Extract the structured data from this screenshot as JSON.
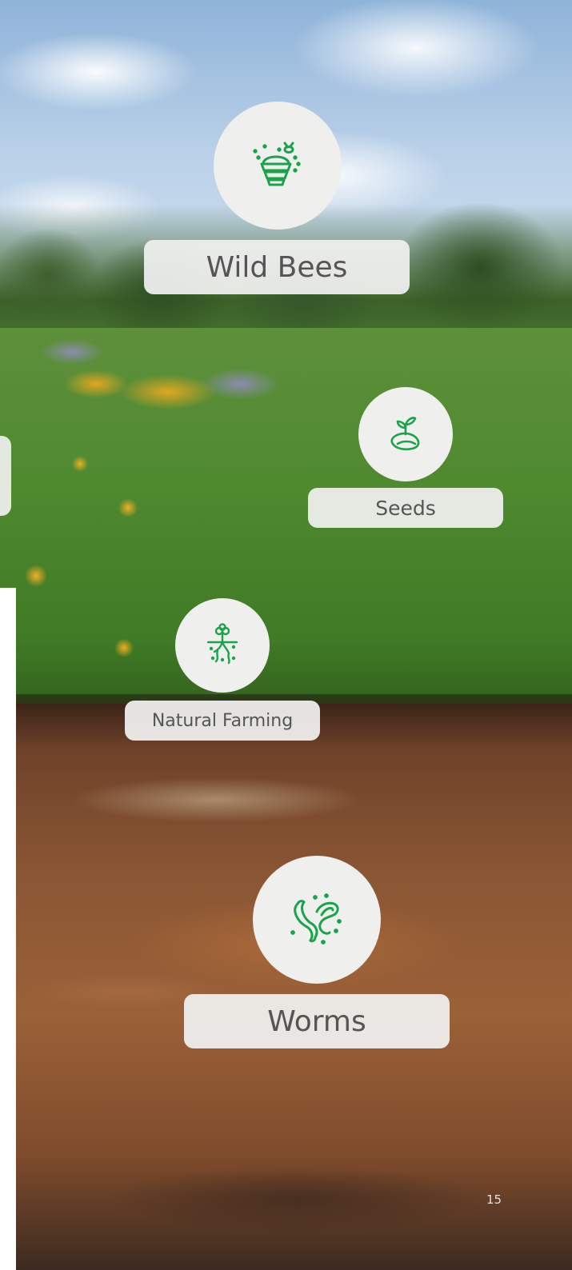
{
  "accent_color": "#1aa34a",
  "items": {
    "wild_bees": {
      "label": "Wild Bees",
      "icon": "bee-hive-icon"
    },
    "seeds": {
      "label": "Seeds",
      "icon": "sprouting-seed-icon"
    },
    "natural_farming": {
      "label": "Natural Farming",
      "icon": "plant-roots-icon"
    },
    "worms": {
      "label": "Worms",
      "icon": "worms-icon"
    }
  },
  "page_number": "15"
}
